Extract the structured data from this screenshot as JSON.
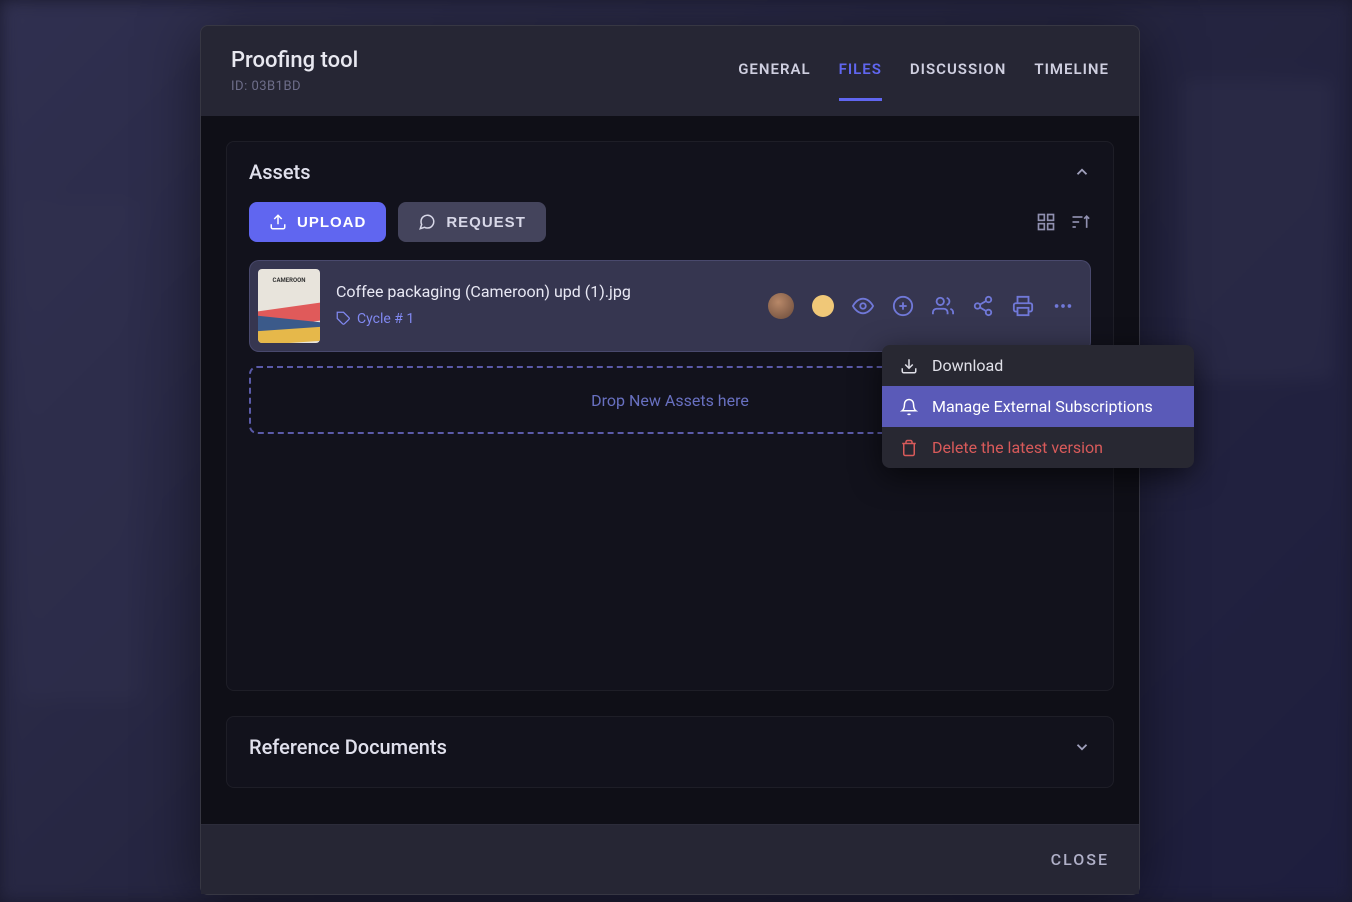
{
  "header": {
    "title": "Proofing tool",
    "id_label": "ID: 03B1BD"
  },
  "tabs": {
    "general": "GENERAL",
    "files": "FILES",
    "discussion": "DISCUSSION",
    "timeline": "TIMELINE"
  },
  "assets": {
    "title": "Assets",
    "upload_label": "UPLOAD",
    "request_label": "REQUEST",
    "items": [
      {
        "name": "Coffee packaging (Cameroon) upd (1).jpg",
        "cycle": "Cycle # 1",
        "thumb_label": "CAMEROON"
      }
    ],
    "dropzone_text": "Drop New Assets here"
  },
  "reference": {
    "title": "Reference Documents"
  },
  "footer": {
    "close": "CLOSE"
  },
  "context_menu": {
    "download": "Download",
    "manage": "Manage External Subscriptions",
    "delete": "Delete the latest version"
  }
}
